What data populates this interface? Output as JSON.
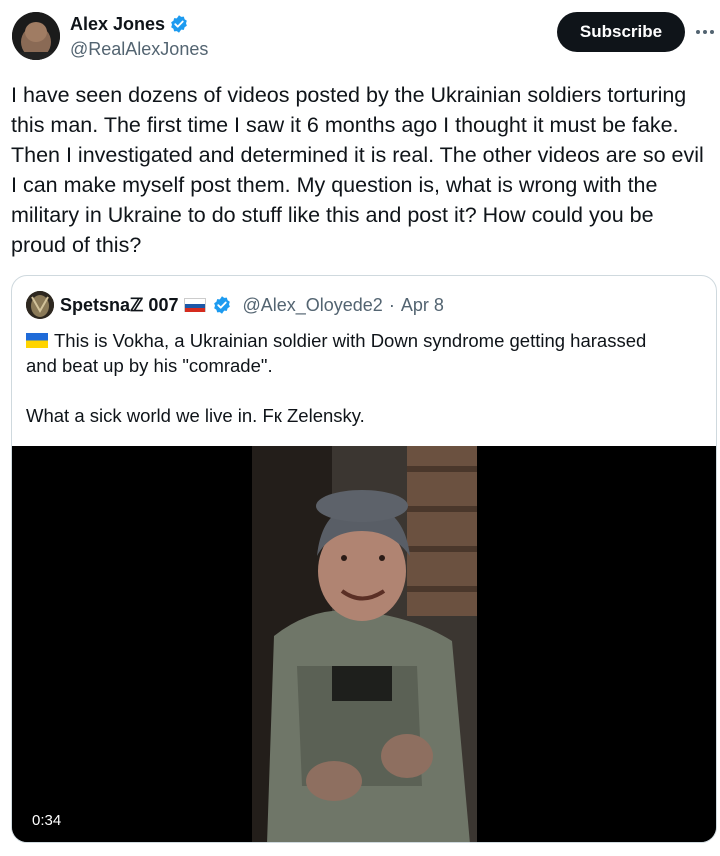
{
  "author": {
    "display_name": "Alex Jones",
    "handle": "@RealAlexJones",
    "verified_icon": "verified-badge-icon"
  },
  "actions": {
    "subscribe_label": "Subscribe",
    "more_icon": "more-horizontal-icon"
  },
  "tweet": {
    "text": "I have seen dozens of videos posted by the Ukrainian soldiers torturing\nthis man. The first time I saw it 6 months ago I thought it must be fake.\nThen I investigated and determined it is real. The other videos are so evil\nI can make myself post them. My question is, what is wrong with the\nmilitary in Ukraine to do stuff like this and post it? How could you be\nproud of this?"
  },
  "quote": {
    "display_name": "Spetsnaℤ 007",
    "handle": "@Alex_Oloyede2",
    "separator": "·",
    "date": "Apr 8",
    "text_line1": "This is Vokha, a Ukrainian soldier with Down syndrome getting harassed\nand beat up by his \"comrade\".",
    "text_line2": "What a sick world we live in. Fк Zelensky.",
    "video": {
      "duration": "0:34"
    }
  },
  "colors": {
    "text_primary": "#0f1419",
    "text_secondary": "#536471",
    "verified_blue": "#1d9bf0",
    "border": "#cfd9de",
    "button_bg": "#0f1419"
  }
}
